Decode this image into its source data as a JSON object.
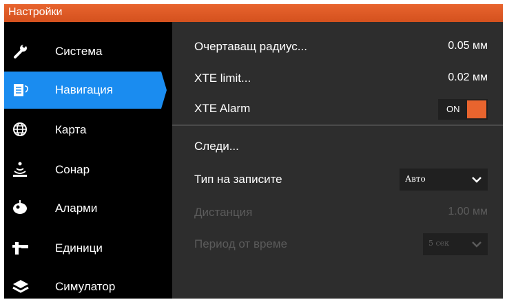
{
  "window": {
    "title": "Настройки"
  },
  "sidebar": {
    "items": [
      {
        "label": "Система",
        "icon": "wrench-icon"
      },
      {
        "label": "Навигация",
        "icon": "navigation-document-icon",
        "active": true
      },
      {
        "label": "Карта",
        "icon": "globe-icon"
      },
      {
        "label": "Сонар",
        "icon": "sonar-icon"
      },
      {
        "label": "Аларми",
        "icon": "alarm-icon"
      },
      {
        "label": "Единици",
        "icon": "units-icon"
      },
      {
        "label": "Симулатор",
        "icon": "layers-icon"
      }
    ]
  },
  "main": {
    "arrival_radius": {
      "label": "Очертаващ радиус...",
      "value": "0.05 мм"
    },
    "xte_limit": {
      "label": "XTE limit...",
      "value": "0.02 мм"
    },
    "xte_alarm": {
      "label": "XTE Alarm",
      "toggle_text": "ON"
    },
    "trails": {
      "label": "Следи..."
    },
    "record_type": {
      "label": "Тип на записите",
      "value": "Авто"
    },
    "distance": {
      "label": "Дистанция",
      "value": "1.00 мм",
      "disabled": true
    },
    "time_period": {
      "label": "Период от време",
      "value": "5 сек",
      "disabled": true
    }
  },
  "colors": {
    "accent": "#e8642e",
    "selected": "#1a8cf0",
    "panel": "#2d2d2d",
    "disabled_text": "#5b5b5b"
  }
}
